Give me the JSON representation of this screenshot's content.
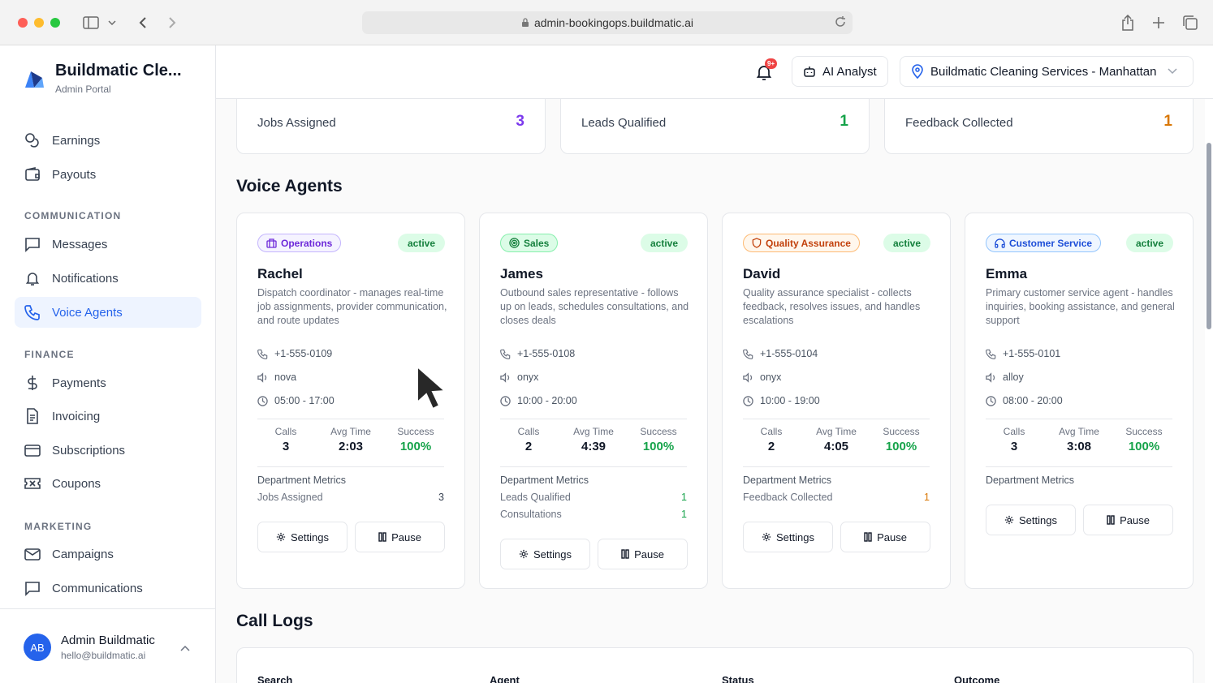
{
  "browser": {
    "url": "admin-bookingops.buildmatic.ai"
  },
  "brand": {
    "title": "Buildmatic Cle...",
    "subtitle": "Admin Portal"
  },
  "sidebar": {
    "items_top": [
      {
        "label": "Earnings"
      },
      {
        "label": "Payouts"
      }
    ],
    "sections": {
      "communication": "COMMUNICATION",
      "finance": "FINANCE",
      "marketing": "MARKETING"
    },
    "communication": [
      {
        "label": "Messages"
      },
      {
        "label": "Notifications"
      },
      {
        "label": "Voice Agents"
      }
    ],
    "finance": [
      {
        "label": "Payments"
      },
      {
        "label": "Invoicing"
      },
      {
        "label": "Subscriptions"
      },
      {
        "label": "Coupons"
      }
    ],
    "marketing": [
      {
        "label": "Campaigns"
      },
      {
        "label": "Communications"
      }
    ]
  },
  "user": {
    "initials": "AB",
    "name": "Admin Buildmatic",
    "email": "hello@buildmatic.ai"
  },
  "header": {
    "notif_count": "9+",
    "ai_analyst": "AI Analyst",
    "location": "Buildmatic Cleaning Services - Manhattan"
  },
  "stats": [
    {
      "label": "Jobs Assigned",
      "value": "3",
      "color": "#7c3aed"
    },
    {
      "label": "Leads Qualified",
      "value": "1",
      "color": "#16a34a"
    },
    {
      "label": "Feedback Collected",
      "value": "1",
      "color": "#d97706"
    }
  ],
  "voice_agents_title": "Voice Agents",
  "call_logs_title": "Call Logs",
  "metric_labels": {
    "calls": "Calls",
    "avg": "Avg Time",
    "success": "Success",
    "dept": "Department Metrics"
  },
  "buttons": {
    "settings": "Settings",
    "pause": "Pause"
  },
  "agents": [
    {
      "dept": "Operations",
      "status": "active",
      "name": "Rachel",
      "desc": "Dispatch coordinator - manages real-time job assignments, provider communication, and route updates",
      "phone": "+1-555-0109",
      "voice": "nova",
      "hours": "05:00 - 17:00",
      "calls": "3",
      "avg": "2:03",
      "success": "100%",
      "dept_metrics": [
        {
          "label": "Jobs Assigned",
          "value": "3"
        }
      ]
    },
    {
      "dept": "Sales",
      "status": "active",
      "name": "James",
      "desc": "Outbound sales representative - follows up on leads, schedules consultations, and closes deals",
      "phone": "+1-555-0108",
      "voice": "onyx",
      "hours": "10:00 - 20:00",
      "calls": "2",
      "avg": "4:39",
      "success": "100%",
      "dept_metrics": [
        {
          "label": "Leads Qualified",
          "value": "1"
        },
        {
          "label": "Consultations",
          "value": "1"
        }
      ]
    },
    {
      "dept": "Quality Assurance",
      "status": "active",
      "name": "David",
      "desc": "Quality assurance specialist - collects feedback, resolves issues, and handles escalations",
      "phone": "+1-555-0104",
      "voice": "onyx",
      "hours": "10:00 - 19:00",
      "calls": "2",
      "avg": "4:05",
      "success": "100%",
      "dept_metrics": [
        {
          "label": "Feedback Collected",
          "value": "1"
        }
      ]
    },
    {
      "dept": "Customer Service",
      "status": "active",
      "name": "Emma",
      "desc": "Primary customer service agent - handles inquiries, booking assistance, and general support",
      "phone": "+1-555-0101",
      "voice": "alloy",
      "hours": "08:00 - 20:00",
      "calls": "3",
      "avg": "3:08",
      "success": "100%",
      "dept_metrics": []
    }
  ],
  "table_headers": [
    "Search",
    "Agent",
    "Status",
    "Outcome"
  ]
}
